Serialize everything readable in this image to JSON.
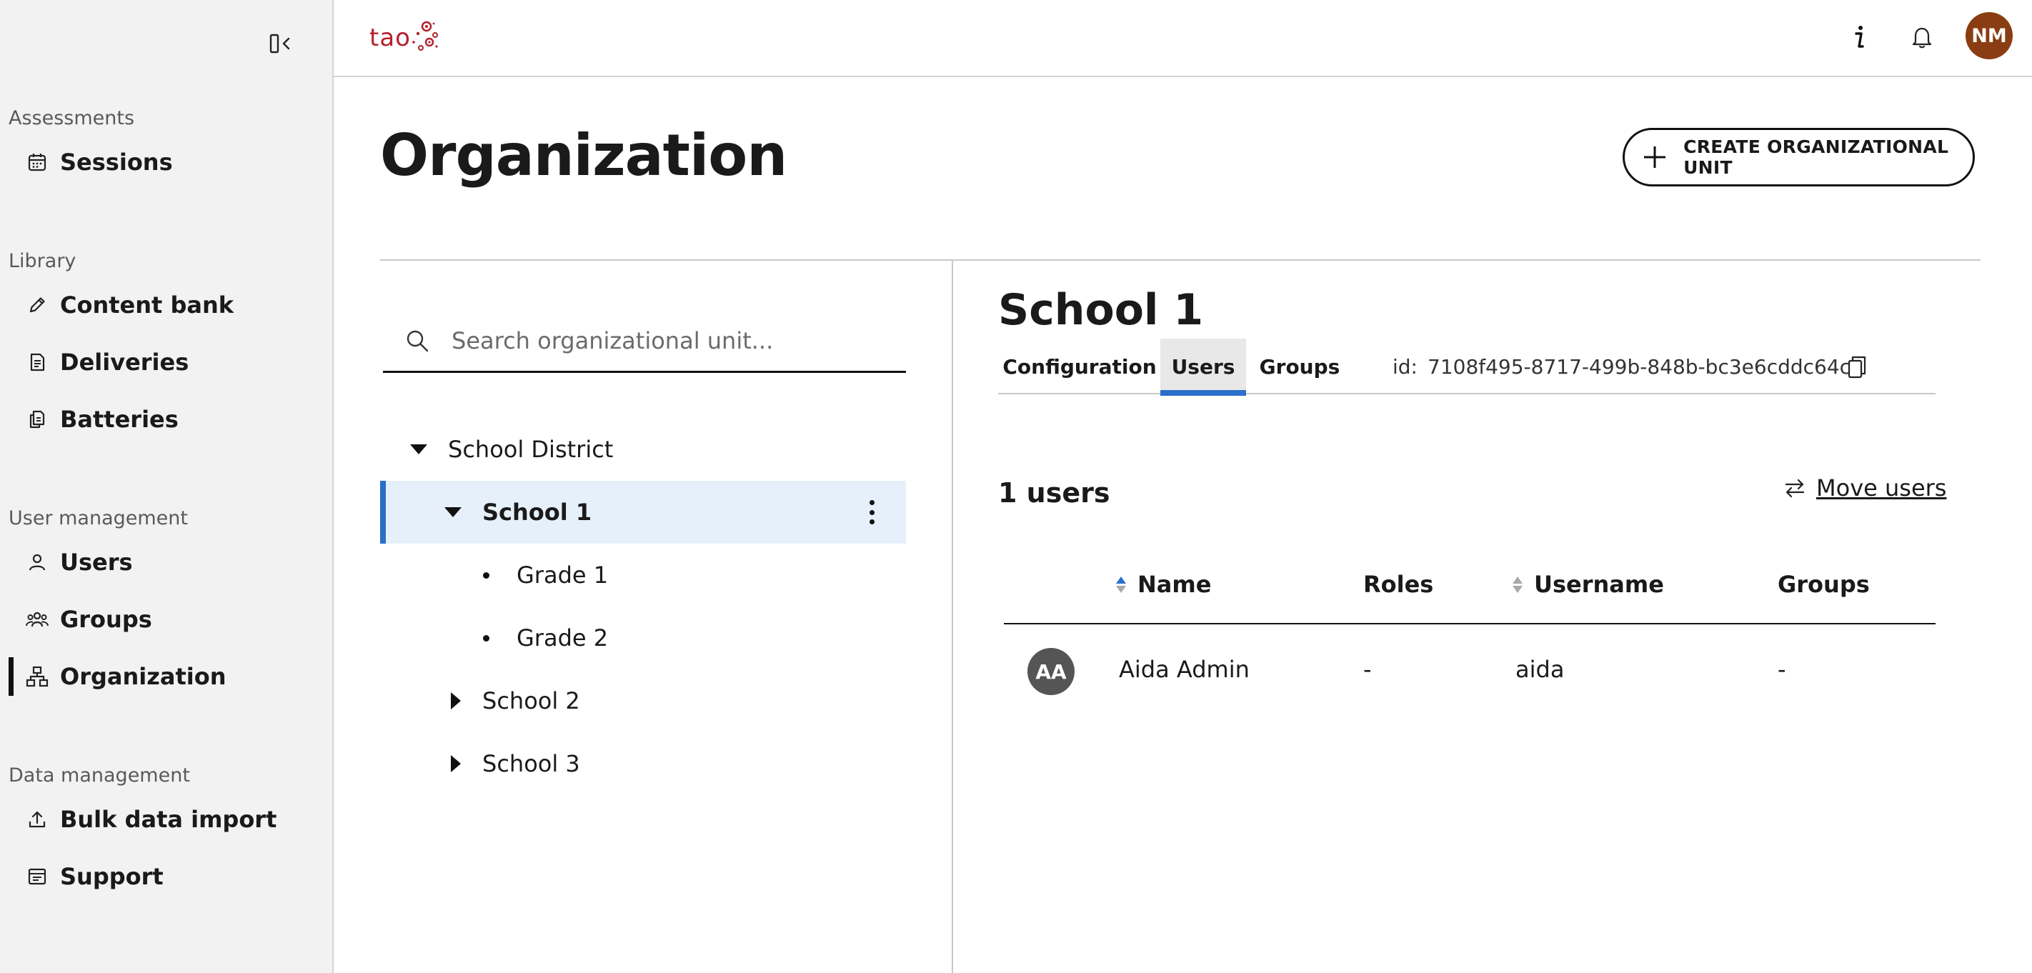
{
  "sidebar": {
    "sections": [
      {
        "label": "Assessments",
        "items": [
          {
            "label": "Sessions",
            "icon": "calendar-icon"
          }
        ]
      },
      {
        "label": "Library",
        "items": [
          {
            "label": "Content bank",
            "icon": "pencil-icon"
          },
          {
            "label": "Deliveries",
            "icon": "document-list-icon"
          },
          {
            "label": "Batteries",
            "icon": "documents-icon"
          }
        ]
      },
      {
        "label": "User management",
        "items": [
          {
            "label": "Users",
            "icon": "user-icon"
          },
          {
            "label": "Groups",
            "icon": "group-icon"
          },
          {
            "label": "Organization",
            "icon": "org-chart-icon",
            "active": true
          }
        ]
      },
      {
        "label": "Data management",
        "items": [
          {
            "label": "Bulk data import",
            "icon": "upload-icon"
          },
          {
            "label": "Support",
            "icon": "support-doc-icon"
          }
        ]
      }
    ]
  },
  "topbar": {
    "logo_text": "tao",
    "user_initials": "NM"
  },
  "page": {
    "title": "Organization",
    "create_button_label": "CREATE ORGANIZATIONAL UNIT"
  },
  "tree": {
    "search_placeholder": "Search organizational unit...",
    "nodes": [
      {
        "label": "School District",
        "state": "expanded",
        "level": 0
      },
      {
        "label": "School 1",
        "state": "expanded",
        "level": 1,
        "selected": true
      },
      {
        "label": "Grade 1",
        "state": "leaf",
        "level": 2
      },
      {
        "label": "Grade 2",
        "state": "leaf",
        "level": 2
      },
      {
        "label": "School 2",
        "state": "collapsed",
        "level": 1
      },
      {
        "label": "School 3",
        "state": "collapsed",
        "level": 1
      }
    ]
  },
  "detail": {
    "title": "School 1",
    "tabs": [
      {
        "label": "Configuration"
      },
      {
        "label": "Users",
        "active": true
      },
      {
        "label": "Groups"
      }
    ],
    "id_prefix": "id:",
    "id_value": "7108f495-8717-499b-848b-bc3e6cddc64c",
    "users_count": "1 users",
    "move_users_label": "Move users",
    "table": {
      "columns": [
        "Name",
        "Roles",
        "Username",
        "Groups"
      ],
      "rows": [
        {
          "initials": "AA",
          "name": "Aida Admin",
          "roles": "-",
          "username": "aida",
          "groups": "-"
        }
      ]
    }
  },
  "colors": {
    "accent": "#2a6fc9",
    "selected_row_bg": "#e6f0fa",
    "brand_red": "#b5202e",
    "user_avatar": "#8a3d12",
    "row_avatar": "#555555",
    "sidebar_bg": "#f2f2f2"
  }
}
